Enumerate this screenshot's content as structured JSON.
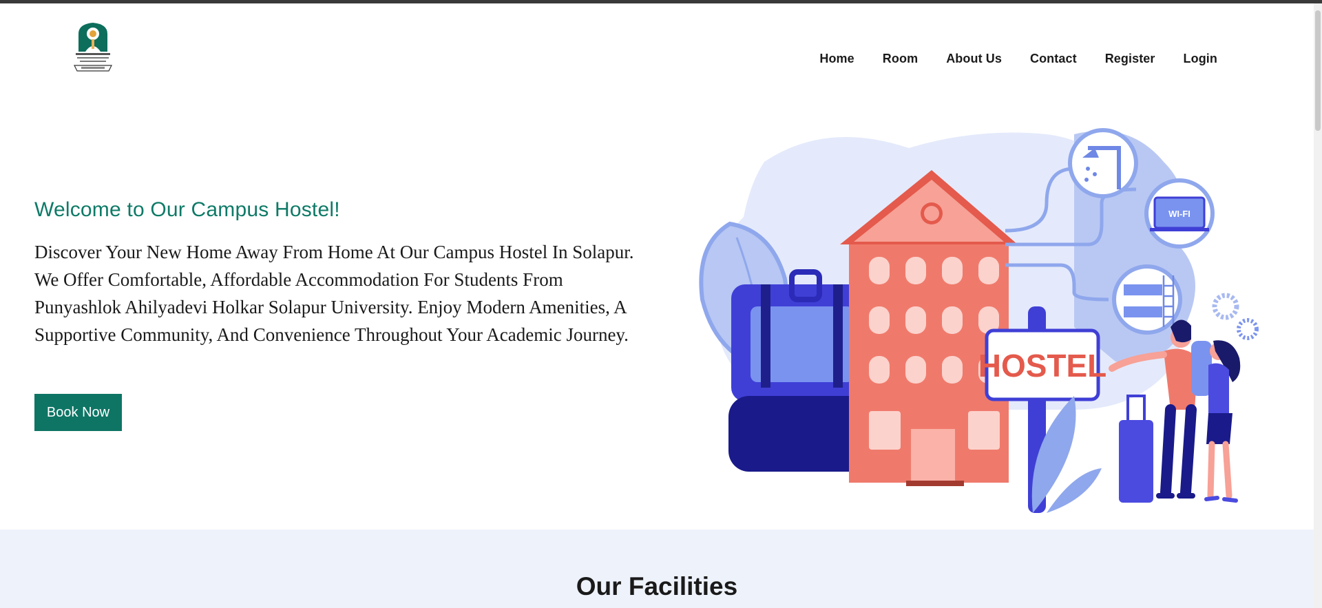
{
  "nav": {
    "items": [
      {
        "label": "Home"
      },
      {
        "label": "Room"
      },
      {
        "label": "About Us"
      },
      {
        "label": "Contact"
      },
      {
        "label": "Register"
      },
      {
        "label": "Login"
      }
    ]
  },
  "hero": {
    "title": "Welcome to Our Campus Hostel!",
    "description": "Discover Your New Home Away From Home At Our Campus Hostel In Solapur. We Offer Comfortable, Affordable Accommodation For Students From Punyashlok Ahilyadevi Holkar Solapur University. Enjoy Modern Amenities, A Supportive Community, And Convenience Throughout Your Academic Journey.",
    "button_label": "Book Now",
    "illustration": {
      "sign_text": "HOSTEL",
      "laptop_text": "WI-FI"
    }
  },
  "facilities": {
    "title": "Our Facilities"
  },
  "colors": {
    "accent": "#0e7565",
    "heading": "#0e7a67",
    "section_bg": "#eef2fb"
  },
  "icons": [
    "university-logo",
    "hostel-illustration"
  ]
}
